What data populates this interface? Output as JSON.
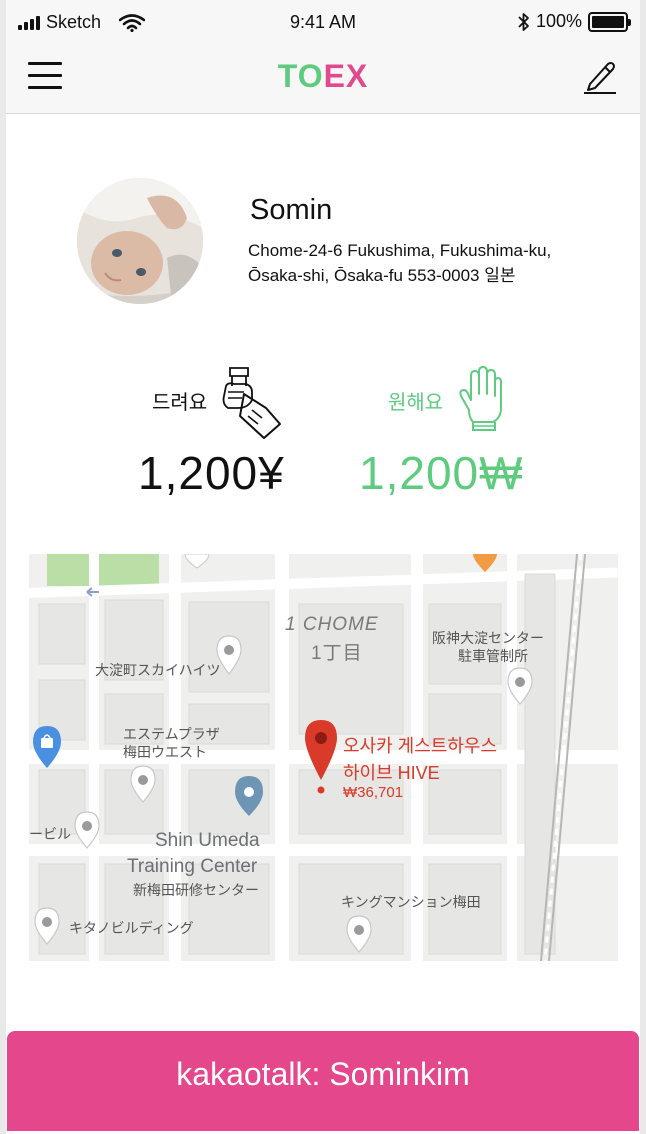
{
  "status_bar": {
    "carrier": "Sketch",
    "time": "9:41 AM",
    "battery": "100%",
    "icons": [
      "signal-icon",
      "wifi-icon",
      "bluetooth-icon",
      "battery-icon"
    ]
  },
  "navbar": {
    "logo_to": "TO",
    "logo_ex": "EX",
    "menu_icon": "hamburger-menu-icon",
    "edit_icon": "pencil-icon"
  },
  "colors": {
    "green": "#5ecb7e",
    "pink": "#e4478b",
    "map_pin_red": "#d93a2a"
  },
  "profile": {
    "name": "Somin",
    "address_line1": "Chome-24-6 Fukushima, Fukushima-ku,",
    "address_line2": "Ōsaka-shi, Ōsaka-fu 553-0003 일본"
  },
  "exchange": {
    "give_label": "드려요",
    "give_icon": "hand-giving-card-icon",
    "give_amount": "1,200¥",
    "want_label": "원해요",
    "want_icon": "open-hand-icon",
    "want_amount": "1,200₩"
  },
  "map": {
    "labels": {
      "chome_en": "1 CHOME",
      "chome_jp": "1丁目",
      "hanshin_1": "阪神大淀センター",
      "hanshin_2": "駐車管制所",
      "skyheights": "大淀町スカイハイツ",
      "estem_1": "エステムプラザ",
      "estem_2": "梅田ウエスト",
      "biru": "ービル",
      "shin_umeda_1": "Shin Umeda",
      "shin_umeda_2": "Training Center",
      "shin_umeda_jp": "新梅田研修センター",
      "king_mansion": "キングマンション梅田",
      "kitano": "キタノビルディング",
      "place_name_1": "오사카 게스트하우스",
      "place_name_2": "하이브 HIVE",
      "place_price": "₩36,701"
    }
  },
  "contact_button": {
    "label": "kakaotalk: Sominkim"
  }
}
